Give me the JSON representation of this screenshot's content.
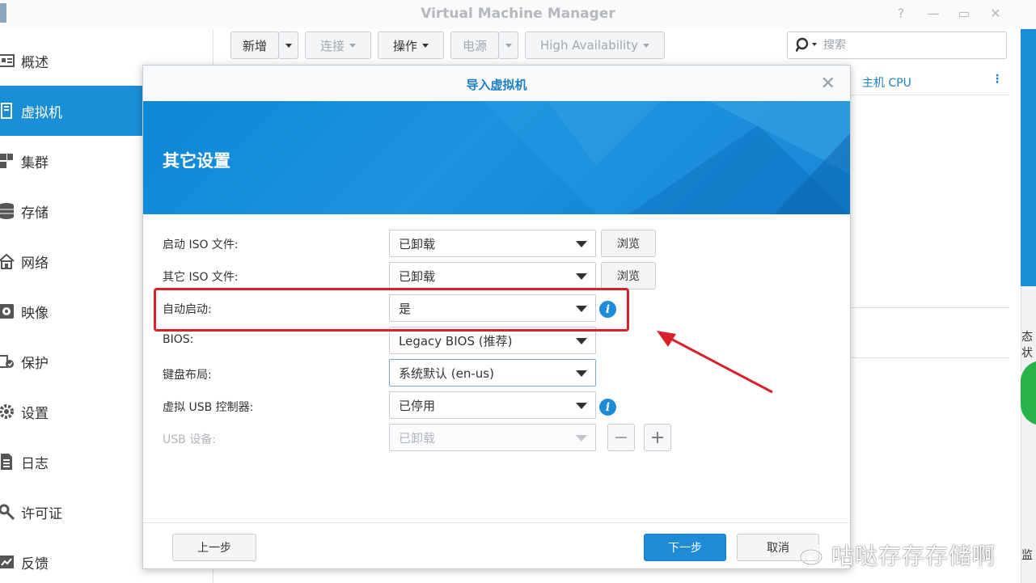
{
  "window": {
    "title": "Virtual Machine Manager"
  },
  "sidebar": {
    "items": [
      {
        "label": "概述",
        "icon": "overview-icon"
      },
      {
        "label": "虚拟机",
        "icon": "vm-icon",
        "active": true
      },
      {
        "label": "集群",
        "icon": "cluster-icon"
      },
      {
        "label": "存储",
        "icon": "storage-icon"
      },
      {
        "label": "网络",
        "icon": "network-icon"
      },
      {
        "label": "映像",
        "icon": "image-icon"
      },
      {
        "label": "保护",
        "icon": "protection-icon"
      },
      {
        "label": "设置",
        "icon": "gear-icon"
      },
      {
        "label": "日志",
        "icon": "log-icon"
      },
      {
        "label": "许可证",
        "icon": "key-icon"
      },
      {
        "label": "反馈",
        "icon": "feedback-icon"
      }
    ]
  },
  "toolbar": {
    "new_label": "新增",
    "connect_label": "连接",
    "action_label": "操作",
    "power_label": "电源",
    "ha_label": "High Availability",
    "search_placeholder": "搜索"
  },
  "table": {
    "column_host_cpu": "主机 CPU"
  },
  "right_partial": {
    "status_fragment": "态状",
    "bottom_fragment": "监"
  },
  "dialog": {
    "title": "导入虚拟机",
    "banner_title": "其它设置",
    "fields": {
      "boot_iso": {
        "label": "启动 ISO 文件:",
        "value": "已卸载",
        "browse": "浏览"
      },
      "other_iso": {
        "label": "其它 ISO 文件:",
        "value": "已卸载",
        "browse": "浏览"
      },
      "autostart": {
        "label": "自动启动:",
        "value": "是"
      },
      "bios": {
        "label": "BIOS:",
        "value": "Legacy BIOS (推荐)"
      },
      "keyboard": {
        "label": "键盘布局:",
        "value": "系统默认 (en-us)"
      },
      "usb_controller": {
        "label": "虚拟 USB 控制器:",
        "value": "已停用"
      },
      "usb_device": {
        "label": "USB 设备:",
        "value": "已卸载"
      }
    },
    "buttons": {
      "back": "上一步",
      "next": "下一步",
      "cancel": "取消"
    }
  },
  "colors": {
    "accent": "#1a8fd8",
    "highlight_red": "#d9212c"
  },
  "watermark": {
    "text": "咕哒存存存储啊"
  }
}
